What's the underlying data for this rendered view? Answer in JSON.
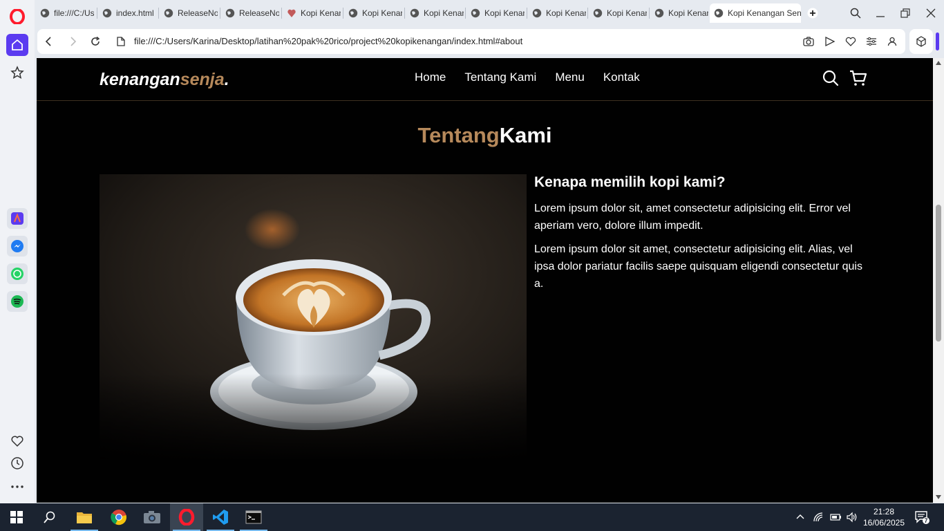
{
  "browser": {
    "tabs": [
      {
        "label": "file:///C:/Us"
      },
      {
        "label": "index.html"
      },
      {
        "label": "ReleaseNot"
      },
      {
        "label": "ReleaseNot"
      },
      {
        "label": "Kopi Kenan"
      },
      {
        "label": "Kopi Kenan"
      },
      {
        "label": "Kopi Kenan"
      },
      {
        "label": "Kopi Kenan"
      },
      {
        "label": "Kopi Kenan"
      },
      {
        "label": "Kopi Kenan"
      },
      {
        "label": "Kopi Kenan"
      },
      {
        "label": "Kopi Kenangan Sen"
      }
    ],
    "url": "file:///C:/Users/Karina/Desktop/latihan%20pak%20rico/project%20kopikenangan/index.html#about",
    "accent_color": "#5b3bf0"
  },
  "site": {
    "logo_main": "kenangan",
    "logo_accent": "senja",
    "logo_dot": ".",
    "menu": [
      {
        "label": "Home"
      },
      {
        "label": "Tentang Kami"
      },
      {
        "label": "Menu"
      },
      {
        "label": "Kontak"
      }
    ],
    "accent_color": "#b6895b"
  },
  "about": {
    "title_accent": "Tentang",
    "title_main": "Kami",
    "heading": "Kenapa memilih kopi kami?",
    "paragraphs": [
      "Lorem ipsum dolor sit, amet consectetur adipisicing elit. Error vel aperiam vero, dolore illum impedit.",
      "Lorem ipsum dolor sit amet, consectetur adipisicing elit. Alias, vel ipsa dolor pariatur facilis saepe quisquam eligendi consectetur quis a."
    ]
  },
  "taskbar": {
    "time": "21:28",
    "date": "16/06/2025",
    "notification_count": "7"
  }
}
